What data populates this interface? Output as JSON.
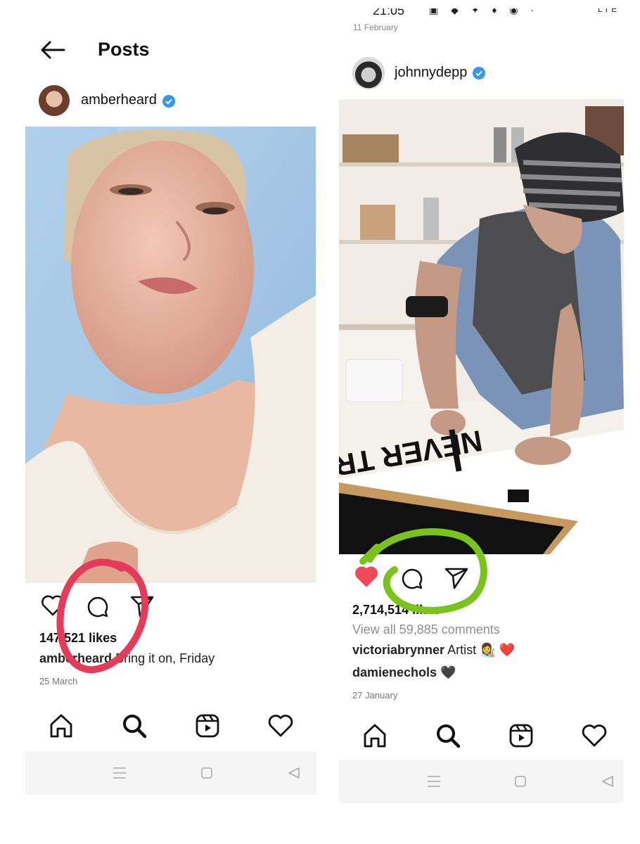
{
  "left": {
    "header": {
      "title": "Posts"
    },
    "username": "amberheard",
    "likes": "147,521 likes",
    "caption": {
      "user": "amberheard",
      "text": "Bring it on, Friday"
    },
    "date": "25 March",
    "annotation_color": "#e53b5a"
  },
  "right": {
    "status_time": "21:05",
    "status_right": "LTE",
    "prev_date": "11 February",
    "username": "johnnydepp",
    "likes": "2,714,514 likes",
    "view_comments": "View all 59,885 comments",
    "comments": [
      {
        "user": "victoriabrynner",
        "text": "Artist 👩‍🎨 ❤️"
      },
      {
        "user": "damienechols",
        "text": "🖤"
      }
    ],
    "date": "27 January",
    "annotation_color": "#7ac21c",
    "liked": true
  },
  "colors": {
    "verified": "#3897f0",
    "heart_liked": "#ed4956"
  },
  "icons": [
    "back-arrow-icon",
    "heart-icon",
    "comment-icon",
    "share-icon",
    "home-icon",
    "search-icon",
    "reels-icon",
    "activity-heart-icon",
    "menu-lines-icon",
    "square-icon",
    "back-triangle-icon",
    "verified-badge-icon"
  ]
}
